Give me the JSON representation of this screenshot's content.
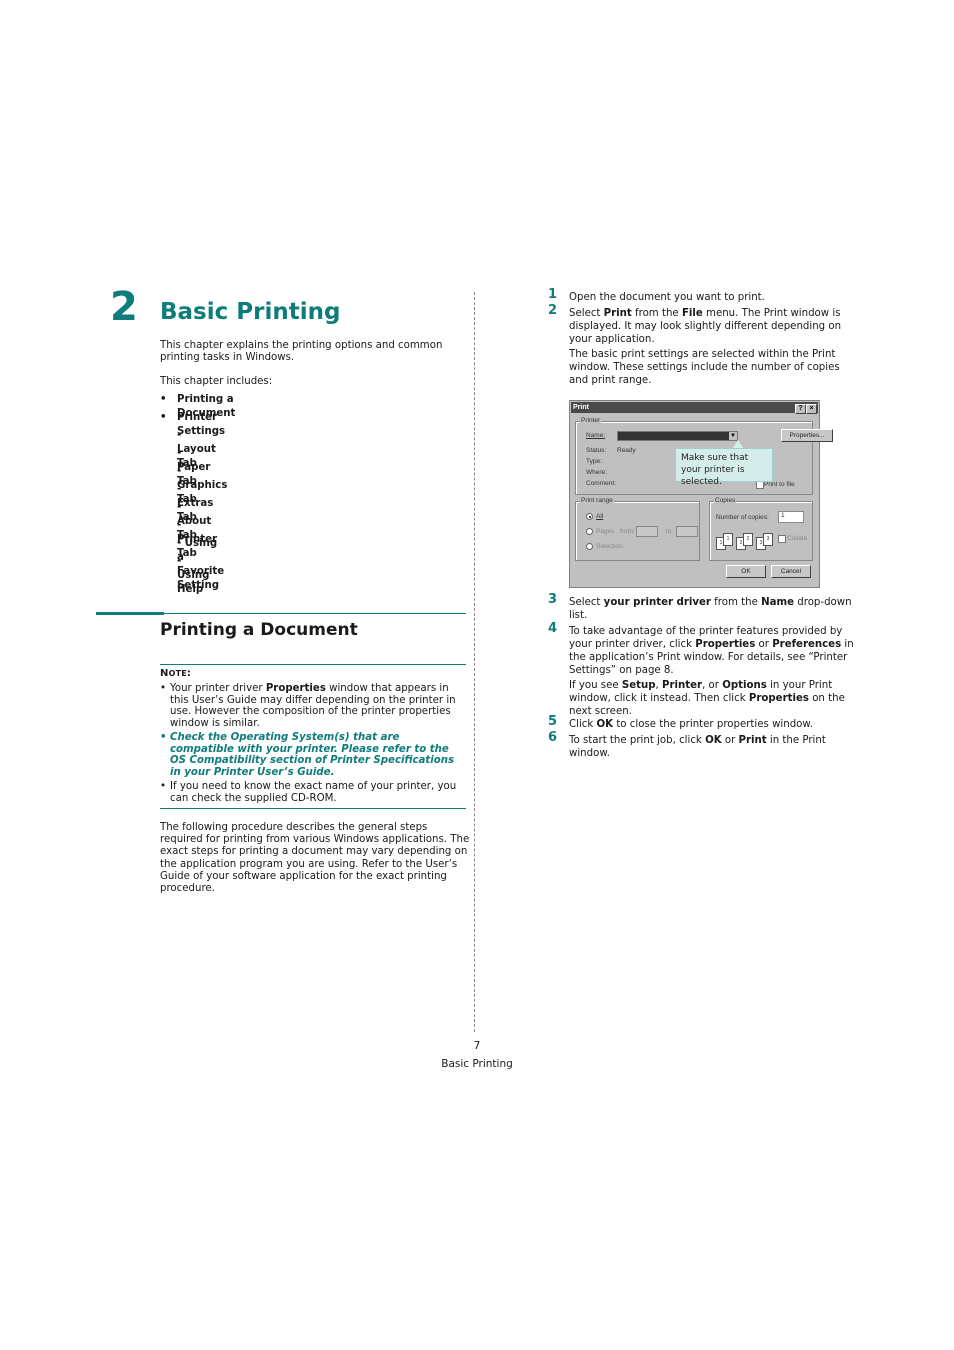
{
  "chapter": {
    "number": "2",
    "title": "Basic Printing",
    "intro": "This chapter explains the printing options and common printing tasks in Windows.",
    "includes_label": "This chapter includes:",
    "toc": [
      {
        "bullet": "•",
        "label": "Printing a Document"
      },
      {
        "bullet": "•",
        "label": "Printer Settings"
      },
      {
        "bullet": "",
        "label": "- Layout Tab"
      },
      {
        "bullet": "",
        "label": "- Paper Tab"
      },
      {
        "bullet": "",
        "label": "- Graphics Tab"
      },
      {
        "bullet": "",
        "label": "- Extras Tab"
      },
      {
        "bullet": "",
        "label": "- About Tab"
      },
      {
        "bullet": "",
        "label": "- Printer Tab"
      },
      {
        "bullet": "",
        "label": "- Using a Favorite Setting"
      },
      {
        "bullet": "",
        "label": "- Using Help"
      }
    ]
  },
  "section": {
    "title": "Printing a Document",
    "note_label": "Note:",
    "notes": [
      {
        "pre": "Your printer driver ",
        "bold": "Properties",
        "post": " window that appears in this User’s Guide may differ depending on the printer in use. However the composition of the printer properties window is similar."
      },
      {
        "text": "Check the Operating System(s) that are compatible with your printer. Please refer to the OS Compatibility section of Printer Specifications in your Printer User’s Guide."
      },
      {
        "text": "If you need to know the exact name of your printer, you can check the supplied CD-ROM."
      }
    ],
    "procedure": "The following procedure describes the general steps required for printing from various Windows applications. The exact steps for printing a document may vary depending on the application program you are using. Refer to the User’s Guide of your software application for the exact printing procedure."
  },
  "steps": [
    {
      "num": "1",
      "parts": [
        {
          "t": "Open the document you want to print."
        }
      ]
    },
    {
      "num": "2",
      "parts": [
        {
          "t": "Select "
        },
        {
          "b": "Print"
        },
        {
          "t": " from the "
        },
        {
          "b": "File"
        },
        {
          "t": " menu. The Print window is displayed. It may look slightly different depending on your application."
        }
      ],
      "extra": "The basic print settings are selected within the Print window. These settings include the number of copies and print range."
    },
    {
      "num": "3",
      "parts": [
        {
          "t": "Select "
        },
        {
          "b": "your printer driver"
        },
        {
          "t": " from the "
        },
        {
          "b": "Name"
        },
        {
          "t": " drop-down list."
        }
      ]
    },
    {
      "num": "4",
      "parts": [
        {
          "t": "To take advantage of the printer features provided by your printer driver, click "
        },
        {
          "b": "Properties"
        },
        {
          "t": " or "
        },
        {
          "b": "Preferences"
        },
        {
          "t": " in the application’s Print window. For details, see “Printer Settings” on page 8."
        }
      ],
      "extra_parts": [
        {
          "t": "If you see "
        },
        {
          "b": "Setup"
        },
        {
          "t": ", "
        },
        {
          "b": "Printer"
        },
        {
          "t": ", or "
        },
        {
          "b": "Options"
        },
        {
          "t": " in your Print window, click it instead. Then click "
        },
        {
          "b": "Properties"
        },
        {
          "t": " on the next screen."
        }
      ]
    },
    {
      "num": "5",
      "parts": [
        {
          "t": "Click "
        },
        {
          "b": "OK"
        },
        {
          "t": " to close the printer properties window."
        }
      ]
    },
    {
      "num": "6",
      "parts": [
        {
          "t": "To start the print job, click "
        },
        {
          "b": "OK"
        },
        {
          "t": " or "
        },
        {
          "b": "Print"
        },
        {
          "t": " in the Print window."
        }
      ]
    }
  ],
  "dialog": {
    "title": "Print",
    "help_btn": "?",
    "close_btn": "×",
    "printer_group": "Printer",
    "name_label": "Name:",
    "properties_btn": "Properties...",
    "status_label": "Status:",
    "status_value": "Ready",
    "type_label": "Type:",
    "where_label": "Where:",
    "comment_label": "Comment:",
    "print_to_file": "Print to file",
    "range_group": "Print range",
    "range_all": "All",
    "range_pages": "Pages",
    "range_from": "from:",
    "range_to": "to:",
    "range_selection": "Selection",
    "copies_group": "Copies",
    "copies_label": "Number of copies:",
    "copies_value": "1",
    "collate": "Collate",
    "ok_btn": "OK",
    "cancel_btn": "Cancel",
    "callout": "Make sure that your printer is selected."
  },
  "footer": {
    "page_number": "7",
    "running_title": "Basic Printing"
  },
  "colors": {
    "accent": "#0e7c7b"
  }
}
